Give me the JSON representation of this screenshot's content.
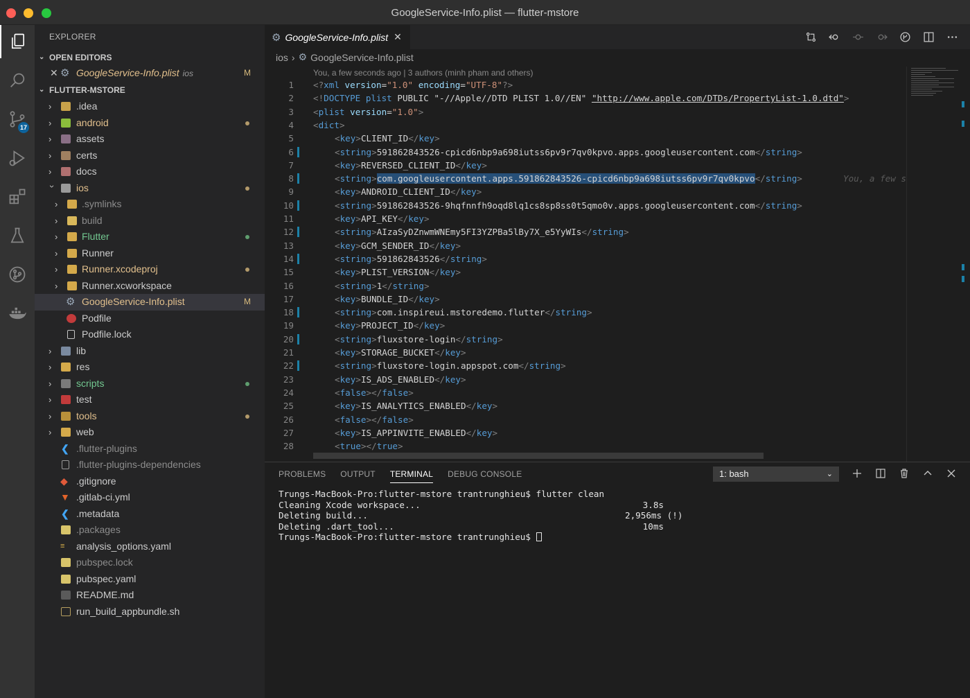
{
  "window": {
    "title": "GoogleService-Info.plist — flutter-mstore"
  },
  "activity": {
    "scm_badge": "17"
  },
  "sidebar": {
    "title": "EXPLORER",
    "open_editors_label": "OPEN EDITORS",
    "open_editor": {
      "name": "GoogleService-Info.plist",
      "path": "ios",
      "flag": "M"
    },
    "project_label": "FLUTTER-MSTORE",
    "tree": [
      {
        "label": ".idea"
      },
      {
        "label": "android"
      },
      {
        "label": "assets"
      },
      {
        "label": "certs"
      },
      {
        "label": "docs"
      },
      {
        "label": "ios"
      },
      {
        "label": ".symlinks"
      },
      {
        "label": "build"
      },
      {
        "label": "Flutter"
      },
      {
        "label": "Runner"
      },
      {
        "label": "Runner.xcodeproj"
      },
      {
        "label": "Runner.xcworkspace"
      },
      {
        "label": "GoogleService-Info.plist",
        "flag": "M"
      },
      {
        "label": "Podfile"
      },
      {
        "label": "Podfile.lock"
      },
      {
        "label": "lib"
      },
      {
        "label": "res"
      },
      {
        "label": "scripts"
      },
      {
        "label": "test"
      },
      {
        "label": "tools"
      },
      {
        "label": "web"
      },
      {
        "label": ".flutter-plugins"
      },
      {
        "label": ".flutter-plugins-dependencies"
      },
      {
        "label": ".gitignore"
      },
      {
        "label": ".gitlab-ci.yml"
      },
      {
        "label": ".metadata"
      },
      {
        "label": ".packages"
      },
      {
        "label": "analysis_options.yaml"
      },
      {
        "label": "pubspec.lock"
      },
      {
        "label": "pubspec.yaml"
      },
      {
        "label": "README.md"
      },
      {
        "label": "run_build_appbundle.sh"
      }
    ]
  },
  "editor": {
    "tab_label": "GoogleService-Info.plist",
    "breadcrumb": {
      "folder": "ios",
      "file": "GoogleService-Info.plist"
    },
    "blame": "You, a few seconds ago | 3 authors (minh pham and others)",
    "inline_blame": "You, a few s",
    "lines": {
      "n1": "1",
      "n2": "2",
      "n3": "3",
      "n4": "4",
      "n5": "5",
      "n6": "6",
      "n7": "7",
      "n8": "8",
      "n9": "9",
      "n10": "10",
      "n11": "11",
      "n12": "12",
      "n13": "13",
      "n14": "14",
      "n15": "15",
      "n16": "16",
      "n17": "17",
      "n18": "18",
      "n19": "19",
      "n20": "20",
      "n21": "21",
      "n22": "22",
      "n23": "23",
      "n24": "24",
      "n25": "25",
      "n26": "26",
      "n27": "27",
      "n28": "28"
    },
    "xml": {
      "decl_version": "\"1.0\"",
      "decl_encoding": "\"UTF-8\"",
      "doctype_public": "\"-//Apple//DTD PLIST 1.0//EN\"",
      "doctype_url": "\"http://www.apple.com/DTDs/PropertyList-1.0.dtd\"",
      "plist_version": "\"1.0\"",
      "k5": "CLIENT_ID",
      "s6": "591862843526-cpicd6nbp9a698iutss6pv9r7qv0kpvo.apps.googleusercontent.com",
      "k7": "REVERSED_CLIENT_ID",
      "s8": "com.googleusercontent.apps.591862843526-cpicd6nbp9a698iutss6pv9r7qv0kpvo",
      "k9": "ANDROID_CLIENT_ID",
      "s10": "591862843526-9hqfnnfh9oqd8lq1cs8sp8ss0t5qmo0v.apps.googleusercontent.com",
      "k11": "API_KEY",
      "s12": "AIzaSyDZnwmWNEmy5FI3YZPBa5lBy7X_e5YyWIs",
      "k13": "GCM_SENDER_ID",
      "s14": "591862843526",
      "k15": "PLIST_VERSION",
      "s16": "1",
      "k17": "BUNDLE_ID",
      "s18": "com.inspireui.mstoredemo.flutter",
      "k19": "PROJECT_ID",
      "s20": "fluxstore-login",
      "k21": "STORAGE_BUCKET",
      "s22": "fluxstore-login.appspot.com",
      "k23": "IS_ADS_ENABLED",
      "k25": "IS_ANALYTICS_ENABLED",
      "k27": "IS_APPINVITE_ENABLED"
    }
  },
  "panel": {
    "tabs": [
      "PROBLEMS",
      "OUTPUT",
      "TERMINAL",
      "DEBUG CONSOLE"
    ],
    "terminal_select": "1: bash",
    "terminal_lines": [
      {
        "text": "Trungs-MacBook-Pro:flutter-mstore trantrunghieu$ flutter clean",
        "time": ""
      },
      {
        "text": "Cleaning Xcode workspace...",
        "time": "3.8s"
      },
      {
        "text": "Deleting build...",
        "time": "2,956ms (!)"
      },
      {
        "text": "Deleting .dart_tool...",
        "time": "10ms"
      }
    ],
    "prompt": "Trungs-MacBook-Pro:flutter-mstore trantrunghieu$ "
  },
  "colors": {
    "modified": "#e2c08d",
    "untracked": "#73c991",
    "accent": "#0e639c",
    "selection": "#264f78"
  }
}
